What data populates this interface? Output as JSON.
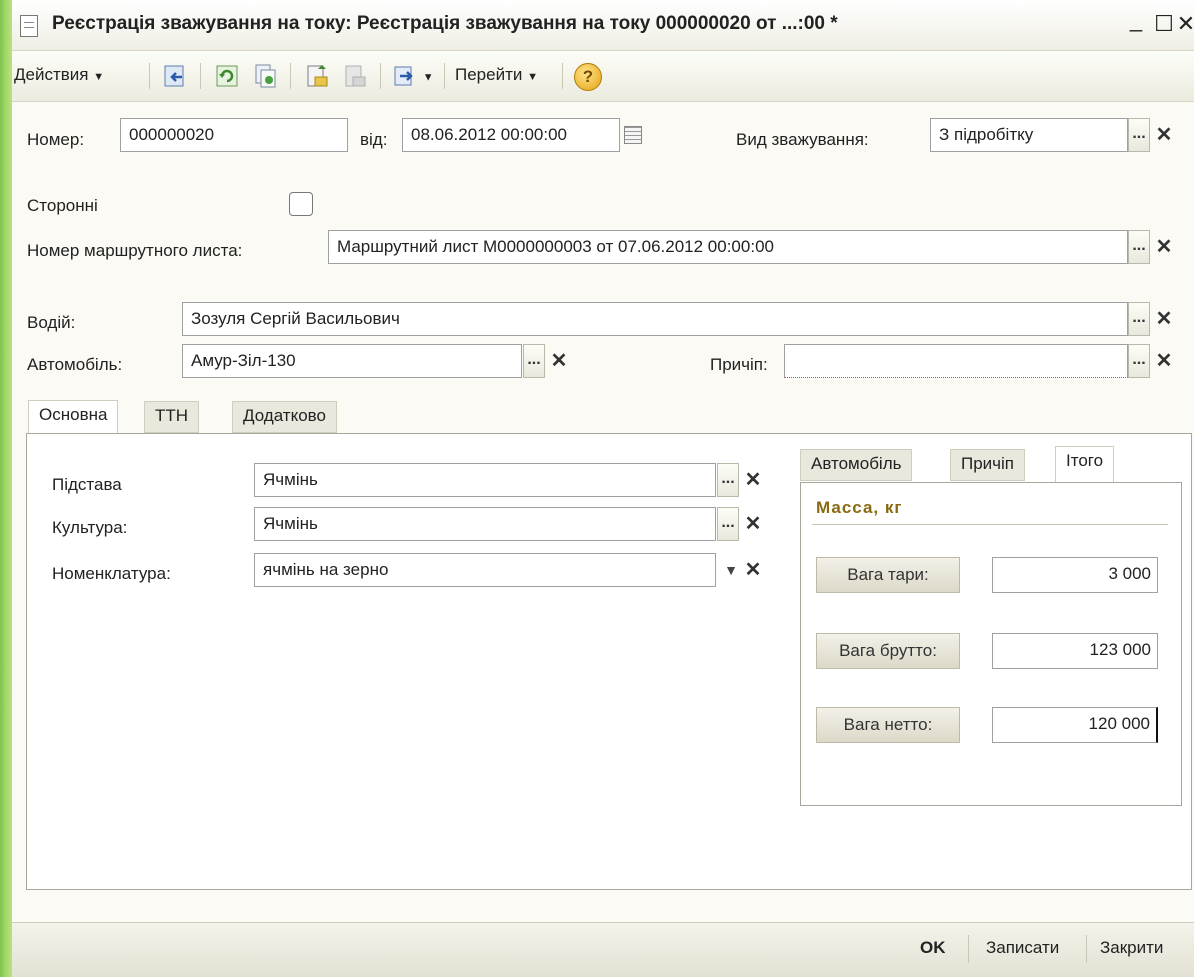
{
  "window": {
    "title": "Реєстрація зважування на току: Реєстрація зважування на току 000000020 от ...:00 *",
    "minimize": "_",
    "maximize": "☐",
    "close": "✕"
  },
  "toolbar": {
    "actions": "Действия",
    "goto": "Перейти",
    "help": "?"
  },
  "form": {
    "number_label": "Номер:",
    "number_value": "000000020",
    "date_label": "від:",
    "date_value": "08.06.2012 00:00:00",
    "weigh_type_label": "Вид зважування:",
    "weigh_type_value": "З підробітку",
    "third_party_label": "Сторонні",
    "route_list_label": "Номер маршрутного листа:",
    "route_list_value": "Маршрутний лист М0000000003 от 07.06.2012 00:00:00",
    "driver_label": "Водій:",
    "driver_value": "Зозуля Сергій Васильович",
    "car_label": "Автомобіль:",
    "car_value": "Амур-Зіл-130",
    "trailer_label": "Причіп:",
    "trailer_value": ""
  },
  "tabs": [
    "Основна",
    "ТТН",
    "Додатково"
  ],
  "main": {
    "basis_label": "Підстава",
    "basis_value": "Ячмінь",
    "culture_label": "Культура:",
    "culture_value": "Ячмінь",
    "nomenclature_label": "Номенклатура:",
    "nomenclature_value": "ячмінь на зерно"
  },
  "subtabs": [
    "Автомобіль",
    "Причіп",
    "Ітого"
  ],
  "mass": {
    "heading": "Масса, кг",
    "tare_label": "Вага тари:",
    "tare_value": "3 000",
    "gross_label": "Вага брутто:",
    "gross_value": "123 000",
    "net_label": "Вага нетто:",
    "net_value": "120 000"
  },
  "footer": {
    "ok": "OK",
    "save": "Записати",
    "close": "Закрити"
  },
  "colors": {
    "heading": "#8a6a10",
    "accent_green": "#7cc24a"
  }
}
